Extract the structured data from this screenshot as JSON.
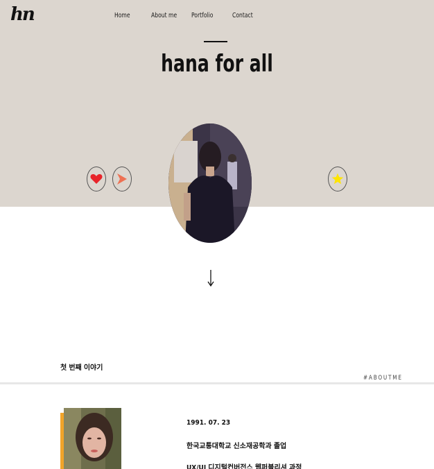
{
  "brand": {
    "logo_text": "hn"
  },
  "nav": {
    "items": [
      "Home",
      "About me",
      "Portfolio",
      "Contact"
    ]
  },
  "hero": {
    "title": "hana for all"
  },
  "about": {
    "section_title": "첫 번째 이야기",
    "section_tag": "#ABOUTME",
    "lines": [
      "1991. 07. 23",
      "한국교통대학교 신소재공학과 졸업",
      "UX/UI 디지털컨버전스 웹퍼블리셔 과정"
    ]
  },
  "colors": {
    "hero_bg": "#dcd6cf",
    "heart": "#e8242a",
    "play": "#ee7153",
    "star": "#ffe500",
    "accent_bar": "#f1a42a"
  },
  "icons": [
    "heart-icon",
    "play-icon",
    "star-icon",
    "arrow-down-icon"
  ]
}
